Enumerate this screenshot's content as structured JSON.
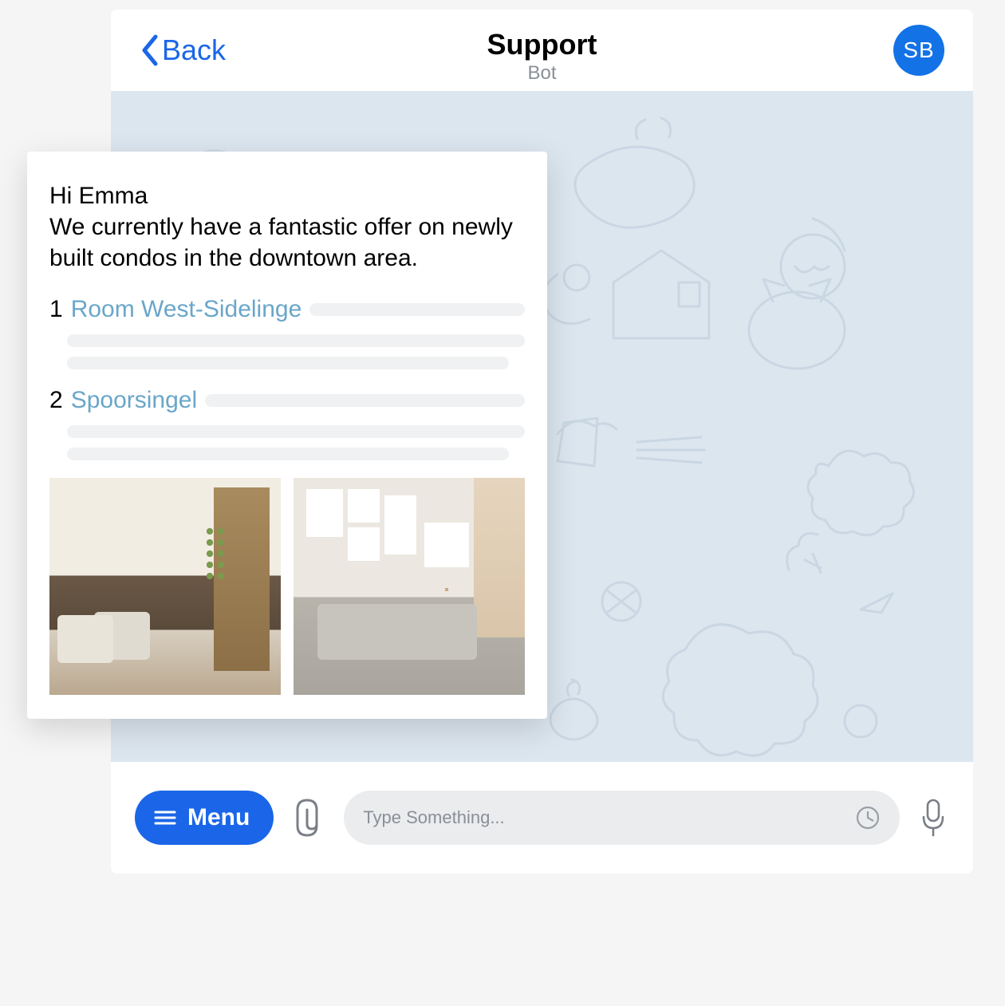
{
  "header": {
    "back_label": "Back",
    "title": "Support",
    "subtitle": "Bot",
    "avatar_initials": "SB"
  },
  "message": {
    "greeting": "Hi Emma",
    "body": "We currently have a fantastic offer on newly built condos in the downtown area.",
    "listings": [
      {
        "num": "1",
        "title": "Room West-Sidelinge"
      },
      {
        "num": "2",
        "title": "Spoorsingel"
      }
    ]
  },
  "input_bar": {
    "menu_label": "Menu",
    "placeholder": "Type Something..."
  },
  "colors": {
    "accent": "#1b66e8",
    "link": "#6aa6c9",
    "avatar_bg": "#1372e6"
  }
}
